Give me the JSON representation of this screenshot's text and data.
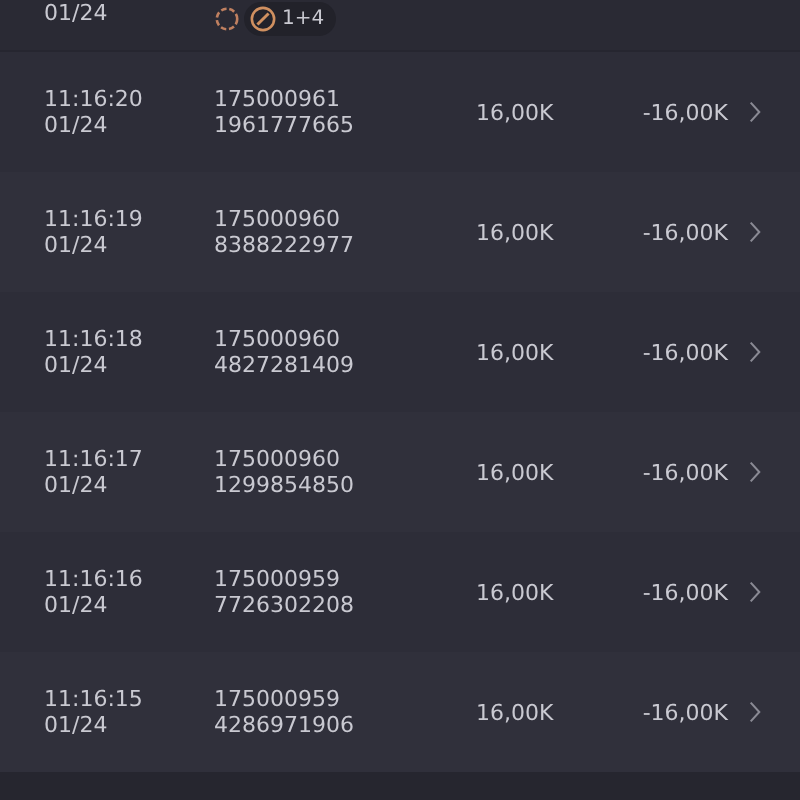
{
  "top_row": {
    "date": "01/24",
    "badge": "1+4"
  },
  "rows": [
    {
      "time": "11:16:20",
      "date": "01/24",
      "order": "175000961",
      "number": "1961777665",
      "bet": "16,00K",
      "result": "-16,00K"
    },
    {
      "time": "11:16:19",
      "date": "01/24",
      "order": "175000960",
      "number": "8388222977",
      "bet": "16,00K",
      "result": "-16,00K"
    },
    {
      "time": "11:16:18",
      "date": "01/24",
      "order": "175000960",
      "number": "4827281409",
      "bet": "16,00K",
      "result": "-16,00K"
    },
    {
      "time": "11:16:17",
      "date": "01/24",
      "order": "175000960",
      "number": "1299854850",
      "bet": "16,00K",
      "result": "-16,00K"
    },
    {
      "time": "11:16:16",
      "date": "01/24",
      "order": "175000959",
      "number": "7726302208",
      "bet": "16,00K",
      "result": "-16,00K"
    },
    {
      "time": "11:16:15",
      "date": "01/24",
      "order": "175000959",
      "number": "4286971906",
      "bet": "16,00K",
      "result": "-16,00K"
    }
  ]
}
